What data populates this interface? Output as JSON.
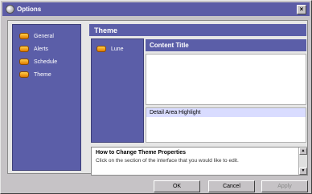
{
  "window": {
    "title": "Options",
    "close_label": "×"
  },
  "sidebar": {
    "items": [
      {
        "label": "General"
      },
      {
        "label": "Alerts"
      },
      {
        "label": "Schedule"
      },
      {
        "label": "Theme"
      }
    ]
  },
  "theme": {
    "header": "Theme",
    "preview_list": [
      {
        "label": "Lune"
      }
    ],
    "content_title": "Content Title",
    "detail_highlight": "Detail Area Highlight"
  },
  "help": {
    "title": "How to Change Theme Properties",
    "text": "Click on the section of the interface that you would like to edit."
  },
  "buttons": {
    "ok": "OK",
    "cancel": "Cancel",
    "apply": "Apply"
  },
  "colors": {
    "accent": "#5b5ea8",
    "titlebar": "#5c5ca6",
    "desktop": "#5a5fc4",
    "detail_highlight": "#d9dcff"
  },
  "icons": {
    "title_icon": "app-icon",
    "item_icon": "orange-pill-icon"
  }
}
